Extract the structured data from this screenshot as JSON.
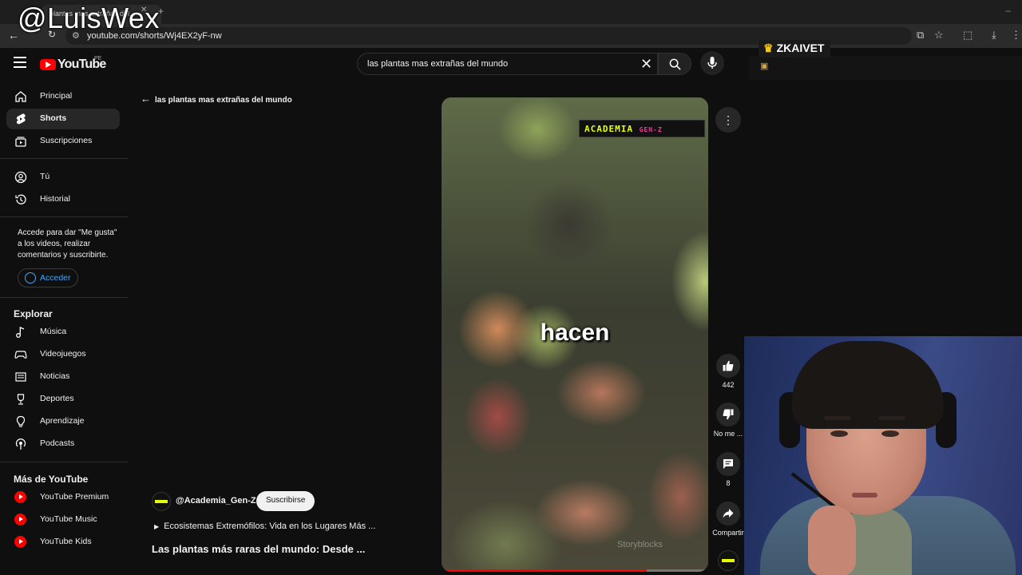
{
  "watermark": "@LuisWex",
  "browser": {
    "tab_title": "plantas mas extrañas del...",
    "url": "youtube.com/shorts/Wj4EX2yF-nw"
  },
  "header": {
    "logo_text": "YouTube",
    "country_code": "PE",
    "search_query": "las plantas mas extrañas del mundo"
  },
  "overlay": {
    "badge_text": "ZKAIVET"
  },
  "sidebar": {
    "main": [
      {
        "label": "Principal",
        "icon": "home-icon"
      },
      {
        "label": "Shorts",
        "icon": "shorts-icon"
      },
      {
        "label": "Suscripciones",
        "icon": "subscriptions-icon"
      }
    ],
    "you": [
      {
        "label": "Tú",
        "icon": "user-icon"
      },
      {
        "label": "Historial",
        "icon": "history-icon"
      }
    ],
    "signin_text": "Accede para dar \"Me gusta\" a los videos, realizar comentarios y suscribirte.",
    "signin_button": "Acceder",
    "explore_title": "Explorar",
    "explore": [
      {
        "label": "Música",
        "icon": "music-icon"
      },
      {
        "label": "Videojuegos",
        "icon": "gaming-icon"
      },
      {
        "label": "Noticias",
        "icon": "news-icon"
      },
      {
        "label": "Deportes",
        "icon": "trophy-icon"
      },
      {
        "label": "Aprendizaje",
        "icon": "lightbulb-icon"
      },
      {
        "label": "Podcasts",
        "icon": "podcast-icon"
      }
    ],
    "more_title": "Más de YouTube",
    "more": [
      {
        "label": "YouTube Premium",
        "icon": "youtube-premium-icon"
      },
      {
        "label": "YouTube Music",
        "icon": "youtube-music-icon"
      },
      {
        "label": "YouTube Kids",
        "icon": "youtube-kids-icon"
      }
    ]
  },
  "main": {
    "back_label": "las plantas mas extrañas del mundo",
    "video": {
      "channel_logo_main": "ACADEMIA",
      "channel_logo_sub": "GEN-Z",
      "caption": "hacen",
      "stock_watermark": "Storyblocks",
      "progress": 0.77
    },
    "actions": {
      "likes": "442",
      "dislike_label": "No me ...",
      "comments": "8",
      "share_label": "Compartir"
    },
    "channel_name": "@Academia_Gen-Z",
    "subscribe_label": "Suscribirse",
    "playlist": "Ecosistemas Extremófilos: Vida en los Lugares Más ...",
    "title": "Las plantas más raras del mundo: Desde ..."
  },
  "colors": {
    "accent": "#ff0000",
    "link": "#3ea6ff",
    "background": "#0f0f0f"
  }
}
